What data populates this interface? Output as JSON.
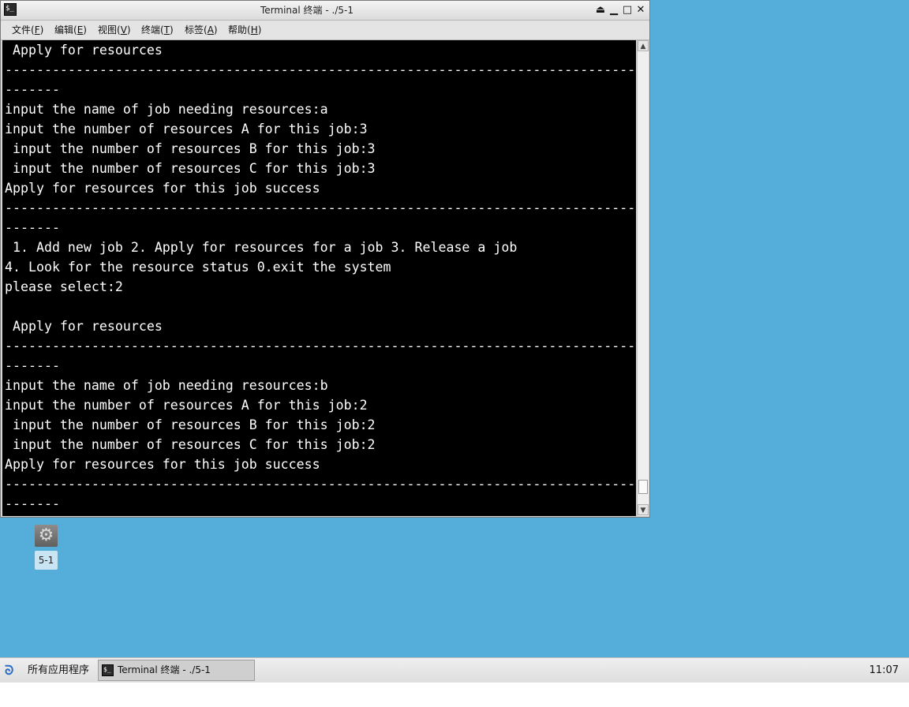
{
  "window": {
    "title": "Terminal 终端 - ./5-1",
    "icon": "terminal-icon",
    "controls": {
      "shade": "⏏",
      "minimize": "▁",
      "maximize": "□",
      "close": "✕"
    }
  },
  "menubar": {
    "items": [
      {
        "label": "文件",
        "mnemonic": "F"
      },
      {
        "label": "编辑",
        "mnemonic": "E"
      },
      {
        "label": "视图",
        "mnemonic": "V"
      },
      {
        "label": "终端",
        "mnemonic": "T"
      },
      {
        "label": "标签",
        "mnemonic": "A"
      },
      {
        "label": "帮助",
        "mnemonic": "H"
      }
    ]
  },
  "terminal": {
    "lines": [
      " Apply for resources",
      "--------------------------------------------------------------------------------",
      "-------",
      "input the name of job needing resources:a",
      "input the number of resources A for this job:3",
      " input the number of resources B for this job:3",
      " input the number of resources C for this job:3",
      "Apply for resources for this job success",
      "--------------------------------------------------------------------------------",
      "-------",
      " 1. Add new job 2. Apply for resources for a job 3. Release a job",
      "4. Look for the resource status 0.exit the system",
      "please select:2",
      "",
      " Apply for resources",
      "--------------------------------------------------------------------------------",
      "-------",
      "input the name of job needing resources:b",
      "input the number of resources A for this job:2",
      " input the number of resources B for this job:2",
      " input the number of resources C for this job:2",
      "Apply for resources for this job success",
      "--------------------------------------------------------------------------------",
      "-------"
    ],
    "colors": {
      "background": "#000000",
      "foreground": "#ffffff"
    }
  },
  "scrollbar": {
    "up": "▲",
    "down": "▼"
  },
  "desktop": {
    "icon": {
      "name": "gear-icon",
      "glyph": "⚙",
      "label": "5-1"
    }
  },
  "taskbar": {
    "start_label": "所有应用程序",
    "start_glyph": "ᘐ",
    "task_label": "Terminal 终端 - ./5-1",
    "clock": "11:07"
  }
}
